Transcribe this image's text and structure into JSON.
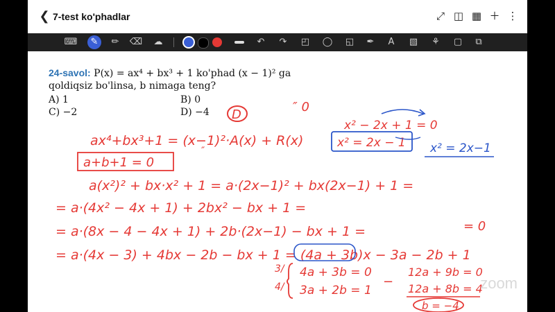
{
  "header": {
    "title": "7-test ko'phadlar",
    "icons": [
      "back-icon",
      "expand-icon",
      "book-icon",
      "layout-icon",
      "add-icon",
      "more-icon"
    ]
  },
  "toolbar": {
    "icons": [
      "keyboard-icon",
      "pen-icon",
      "highlighter-icon",
      "eraser-icon",
      "lasso-icon",
      "color-blue",
      "color-black",
      "color-red",
      "line-tool",
      "undo-icon",
      "redo-icon",
      "ruler-icon",
      "shape-icon",
      "image-icon",
      "marker-icon",
      "text-style-icon",
      "text-box-icon",
      "sticker-icon",
      "page-icon"
    ],
    "colors": {
      "blue": "#3a5fd6",
      "black": "#000000",
      "red": "#e53935"
    }
  },
  "problem": {
    "label": "24-savol:",
    "text_line1": " P(x) = ax⁴ + bx³ + 1 ko'phad (x − 1)² ga",
    "text_line2": "qoldiqsiz bo'linsa, b nimaga teng?",
    "options": {
      "a": "A) 1",
      "b": "B) 0",
      "c": "C) −2",
      "d": "D) −4"
    }
  },
  "handwriting": {
    "answer_mark": "D",
    "mark_zero": "″ 0",
    "line1": "ax⁴+bx³+1 = (x−1)²·A(x) + R(x)",
    "line1_mark": "″",
    "line2": "a+b+1 = 0",
    "blue1": "x² − 2x + 1 = 0",
    "blue2": "x² = 2x − 1",
    "blue3": "x² = 2x−1",
    "line3": "a(x²)² + bx·x² + 1 = a·(2x−1)² + bx(2x−1) + 1 =",
    "line4": "= a·(4x² − 4x + 1) + 2bx² − bx + 1 =",
    "line5": "= a·(8x − 4 − 4x + 1) + 2b·(2x−1) − bx + 1 =",
    "eq_zero": "= 0",
    "line6": "= a·(4x − 3) + 4bx − 2b − bx + 1 = (4a + 3b)x − 3a − 2b + 1",
    "sys_coef1": "3/",
    "sys_coef2": "4/",
    "sys1": "4a + 3b = 0",
    "sys2": "3a + 2b = 1",
    "minus": "−",
    "res1": "12a + 9b = 0",
    "res2": "12a + 8b = 4",
    "answer": "b = −4"
  },
  "watermark": "zoom"
}
